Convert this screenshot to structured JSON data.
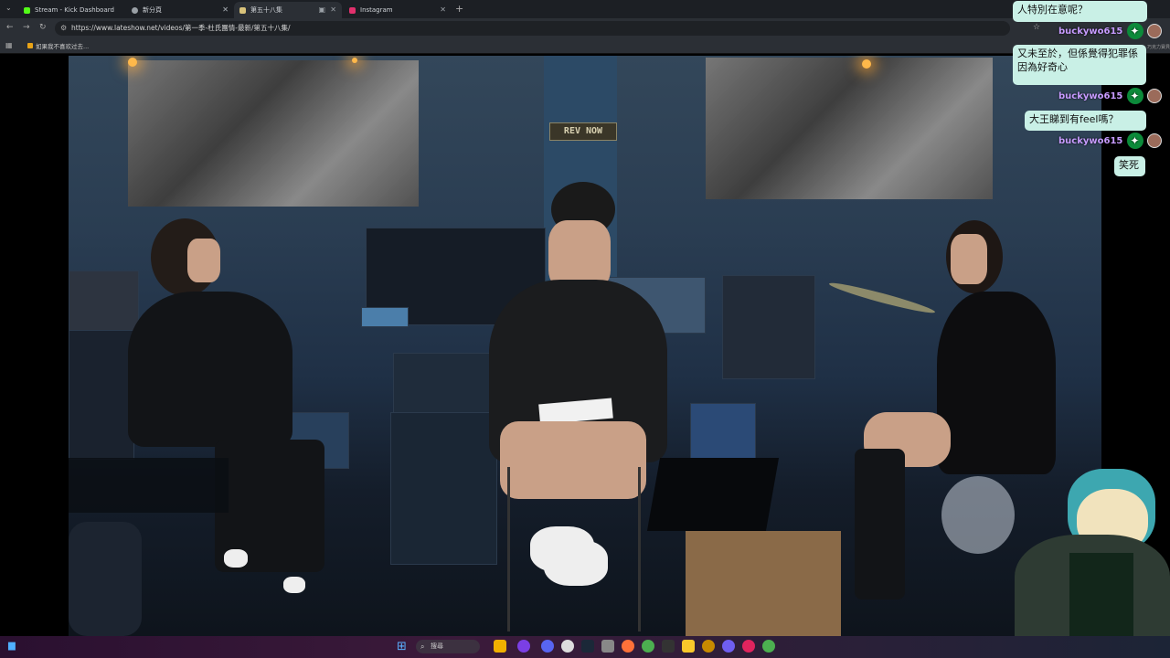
{
  "browser": {
    "tabs": [
      {
        "label": "Stream - Kick Dashboard",
        "favicon_color": "#53fc18",
        "active": false
      },
      {
        "label": "新分頁",
        "favicon_color": "#9aa0a6",
        "active": false
      },
      {
        "label": "第五十八集",
        "favicon_color": "#d8c27a",
        "active": true
      },
      {
        "label": "Instagram",
        "favicon_color": "#e1306c",
        "active": false
      }
    ],
    "new_tab": "+",
    "url": "https://www.lateshow.net/videos/第一季-杜氏團情-最新/第五十八集/",
    "bookmark_label": "如果我不喜欢过去..."
  },
  "video": {
    "sign_text": "REV NOW"
  },
  "chat": {
    "messages": [
      {
        "text": "人特別在意呢？"
      },
      {
        "user": "buckywo615"
      },
      {
        "text": "又未至於，但係覺得犯罪係因為好奇心"
      },
      {
        "user": "buckywo615"
      },
      {
        "text": "大王睇到有feel嗎？"
      },
      {
        "user": "buckywo615"
      },
      {
        "text": "笑死"
      }
    ],
    "top_right_label": "巧克力寶貝",
    "badge_color": "#0c8a3a"
  },
  "taskbar": {
    "search_text": "搜尋"
  }
}
